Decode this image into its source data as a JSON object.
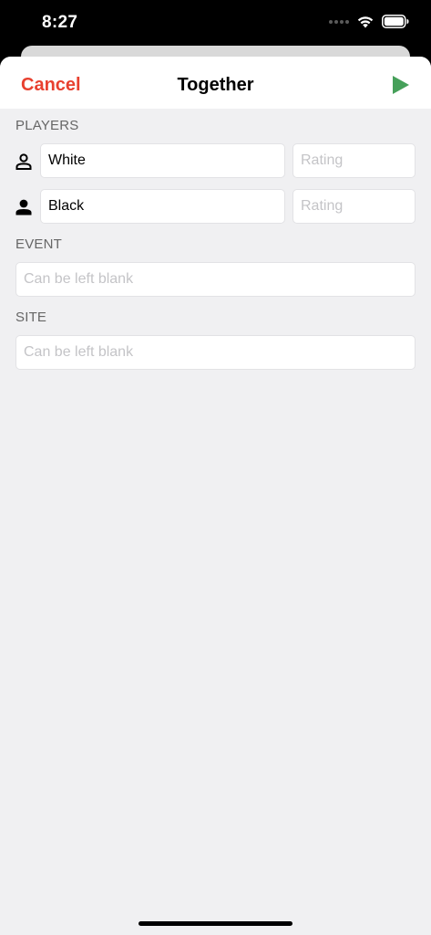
{
  "status_bar": {
    "time": "8:27"
  },
  "nav": {
    "cancel_label": "Cancel",
    "title": "Together",
    "play_icon": "play-icon",
    "accent_color": "#e8402f",
    "play_color": "#46a05a"
  },
  "players": {
    "section_label": "PLAYERS",
    "white": {
      "icon": "person-outline-icon",
      "name_value": "White",
      "rating_placeholder": "Rating"
    },
    "black": {
      "icon": "person-filled-icon",
      "name_value": "Black",
      "rating_placeholder": "Rating"
    }
  },
  "event": {
    "section_label": "EVENT",
    "placeholder": "Can be left blank"
  },
  "site": {
    "section_label": "SITE",
    "placeholder": "Can be left blank"
  }
}
